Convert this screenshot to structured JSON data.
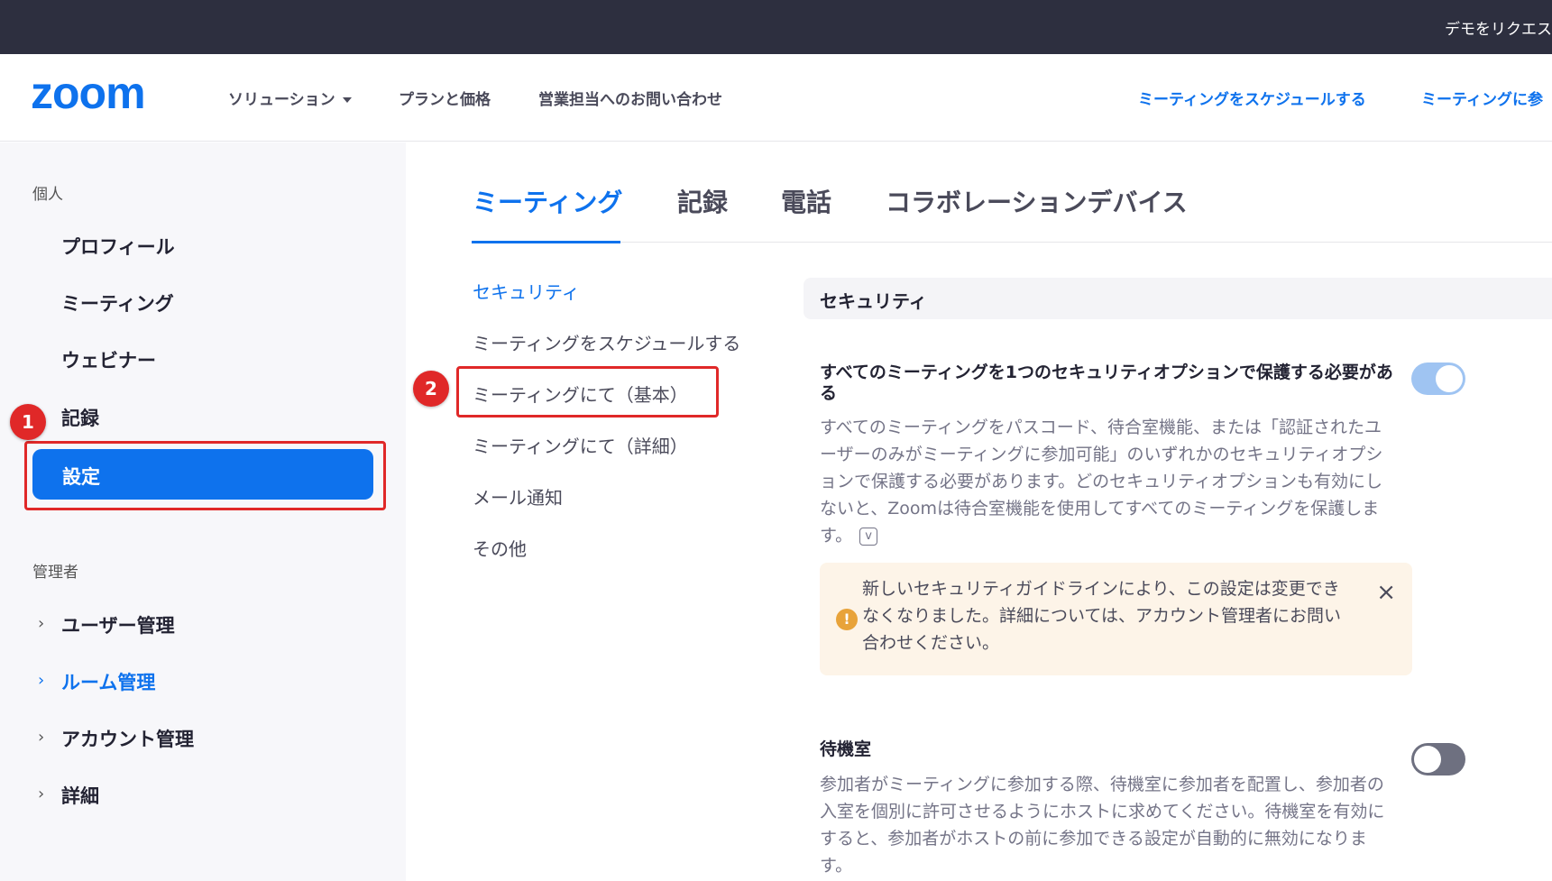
{
  "topbar": {
    "demo_label": "デモをリクエス"
  },
  "header": {
    "logo": "zoom",
    "nav": {
      "solutions": "ソリューション",
      "plans": "プランと価格",
      "contact": "営業担当へのお問い合わせ",
      "schedule": "ミーティングをスケジュールする",
      "join": "ミーティングに参"
    }
  },
  "sidebar": {
    "personal_label": "個人",
    "personal_items": [
      "プロフィール",
      "ミーティング",
      "ウェビナー",
      "記録",
      "設定"
    ],
    "admin_label": "管理者",
    "admin_items": [
      "ユーザー管理",
      "ルーム管理",
      "アカウント管理",
      "詳細"
    ]
  },
  "annotations": {
    "badge_1": "1",
    "badge_2": "2",
    "color": "#e02828"
  },
  "tabs": [
    "ミーティング",
    "記録",
    "電話",
    "コラボレーションデバイス"
  ],
  "subnav": [
    "セキュリティ",
    "ミーティングをスケジュールする",
    "ミーティングにて（基本）",
    "ミーティングにて（詳細）",
    "メール通知",
    "その他"
  ],
  "panel": {
    "section_title": "セキュリティ",
    "setting1": {
      "title": "すべてのミーティングを1つのセキュリティオプションで保護する必要がある",
      "description": "すべてのミーティングをパスコード、待合室機能、または「認証されたユーザーのみがミーティングに参加可能」のいずれかのセキュリティオプションで保護する必要があります。どのセキュリティオプションも有効にしないと、Zoomは待合室機能を使用してすべてのミーティングを保護します。",
      "info_icon": "v",
      "toggle_on": true
    },
    "notice": {
      "icon": "!",
      "text": "新しいセキュリティガイドラインにより、この設定は変更できなくなりました。詳細については、アカウント管理者にお問い合わせください。",
      "close": "×"
    },
    "setting2": {
      "title": "待機室",
      "description": "参加者がミーティングに参加する際、待機室に参加者を配置し、参加者の入室を個別に許可させるようにホストに求めてください。待機室を有効にすると、参加者がホストの前に参加できる設定が自動的に無効になります。",
      "toggle_on": false
    }
  },
  "colors": {
    "accent": "#0e72ed",
    "topbar": "#2d2f3f",
    "sidebar_bg": "#f7f7fa"
  }
}
